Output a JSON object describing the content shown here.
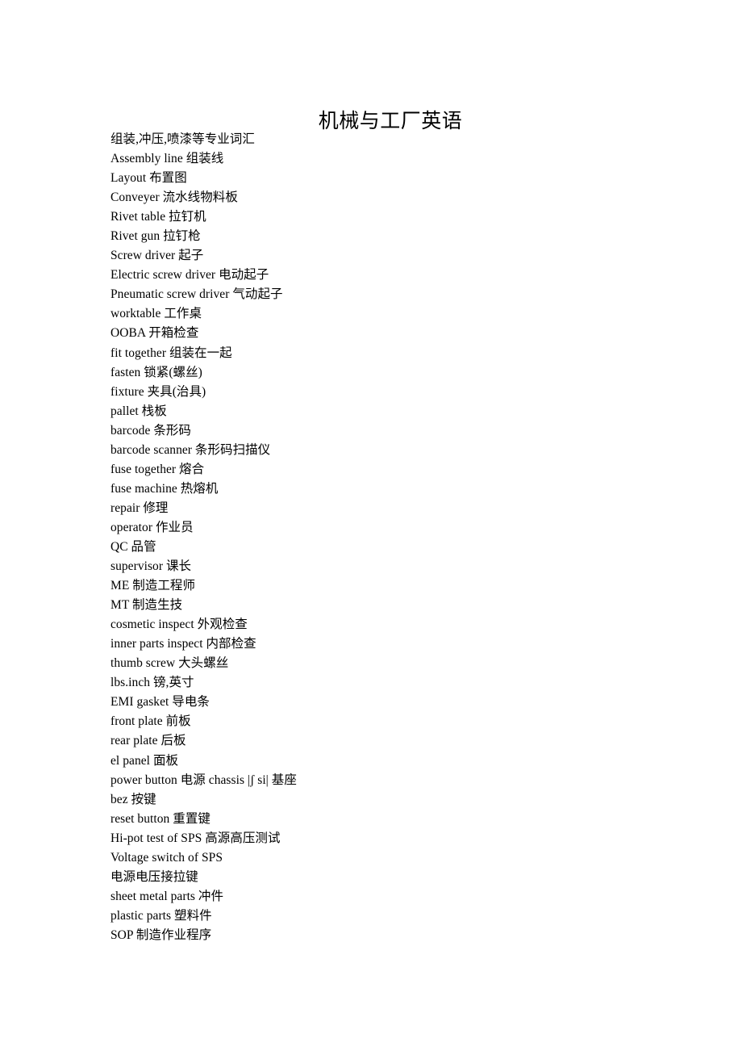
{
  "document": {
    "title": "机械与工厂英语",
    "lines": [
      "组装,冲压,喷漆等专业词汇",
      "Assembly line 组装线",
      "Layout 布置图",
      "Conveyer 流水线物料板",
      "Rivet table 拉钉机",
      "Rivet gun 拉钉枪",
      "Screw driver 起子",
      "Electric screw driver 电动起子",
      "Pneumatic screw driver 气动起子",
      "worktable  工作桌",
      "OOBA 开箱检查",
      "fit together 组装在一起",
      "fasten 锁紧(螺丝)",
      "fixture  夹具(治具)",
      "pallet 栈板",
      "barcode 条形码",
      "barcode scanner 条形码扫描仪",
      "fuse together 熔合",
      "fuse machine 热熔机",
      "repair 修理",
      "operator 作业员",
      "QC 品管",
      "supervisor  课长",
      "ME 制造工程师",
      "MT 制造生技",
      "cosmetic inspect 外观检查",
      "inner parts inspect 内部检查",
      "thumb screw 大头螺丝",
      "lbs.inch 镑,英寸",
      "EMI gasket 导电条",
      "front plate 前板",
      "rear plate 后板",
      "el panel 面板",
      "power button 电源 chassis |ʃ si|  基座",
      "bez 按键",
      "reset button 重置键",
      "Hi-pot test of SPS 高源高压测试",
      "Voltage switch of SPS",
      "电源电压接拉键",
      "sheet metal parts  冲件",
      "plastic parts 塑料件",
      "SOP 制造作业程序"
    ]
  },
  "theme": {
    "background": "#ffffff",
    "text_color": "#000000"
  }
}
